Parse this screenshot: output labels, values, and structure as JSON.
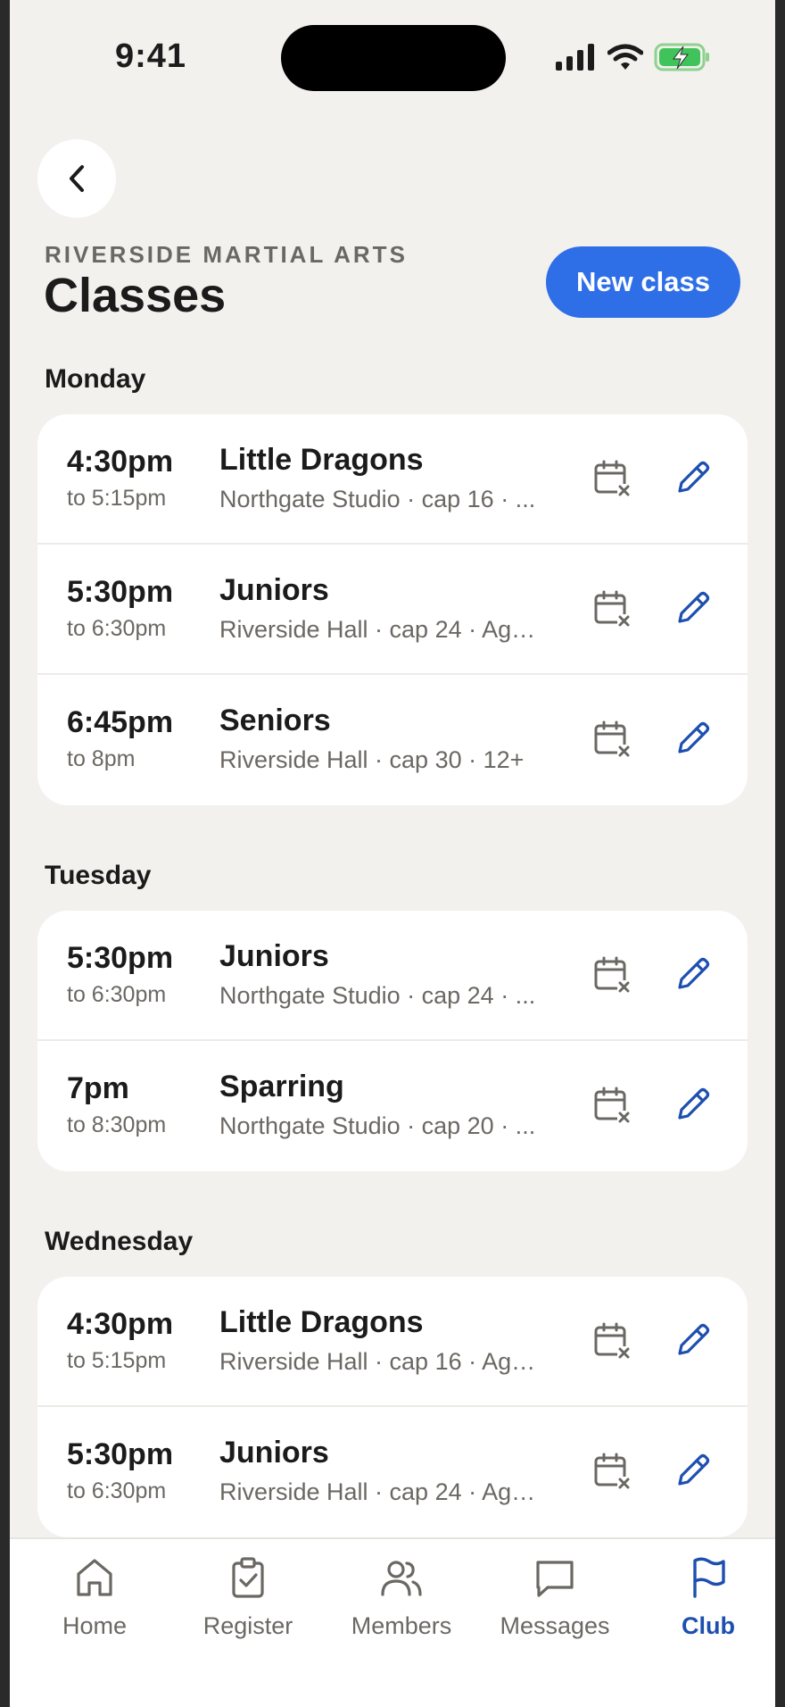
{
  "status_bar": {
    "time": "9:41"
  },
  "header": {
    "back_icon": "chevron-left-icon",
    "eyebrow": "RIVERSIDE MARTIAL ARTS",
    "title": "Classes",
    "new_class_label": "New class"
  },
  "colors": {
    "accent": "#2e6fe8",
    "active_tab": "#1d4fb0",
    "background": "#f2f1ee"
  },
  "days": [
    {
      "name": "Monday",
      "classes": [
        {
          "time": "4:30pm",
          "end": "to 5:15pm",
          "name": "Little Dragons",
          "detail": "Northgate Studio · cap 16 · ..."
        },
        {
          "time": "5:30pm",
          "end": "to 6:30pm",
          "name": "Juniors",
          "detail": "Riverside Hall · cap 24 · Age..."
        },
        {
          "time": "6:45pm",
          "end": "to 8pm",
          "name": "Seniors",
          "detail": "Riverside Hall · cap 30 · 12+"
        }
      ]
    },
    {
      "name": "Tuesday",
      "classes": [
        {
          "time": "5:30pm",
          "end": "to 6:30pm",
          "name": "Juniors",
          "detail": "Northgate Studio · cap 24 · ..."
        },
        {
          "time": "7pm",
          "end": "to 8:30pm",
          "name": "Sparring",
          "detail": "Northgate Studio · cap 20 · ..."
        }
      ]
    },
    {
      "name": "Wednesday",
      "classes": [
        {
          "time": "4:30pm",
          "end": "to 5:15pm",
          "name": "Little Dragons",
          "detail": "Riverside Hall · cap 16 · Age..."
        },
        {
          "time": "5:30pm",
          "end": "to 6:30pm",
          "name": "Juniors",
          "detail": "Riverside Hall · cap 24 · Age..."
        }
      ]
    }
  ],
  "row_icons": {
    "cancel": "calendar-x-icon",
    "edit": "pencil-icon"
  },
  "tabs": [
    {
      "label": "Home",
      "icon": "home-icon",
      "active": false
    },
    {
      "label": "Register",
      "icon": "clipboard-check-icon",
      "active": false
    },
    {
      "label": "Members",
      "icon": "users-icon",
      "active": false
    },
    {
      "label": "Messages",
      "icon": "message-icon",
      "active": false
    },
    {
      "label": "Club",
      "icon": "flag-icon",
      "active": true
    }
  ]
}
